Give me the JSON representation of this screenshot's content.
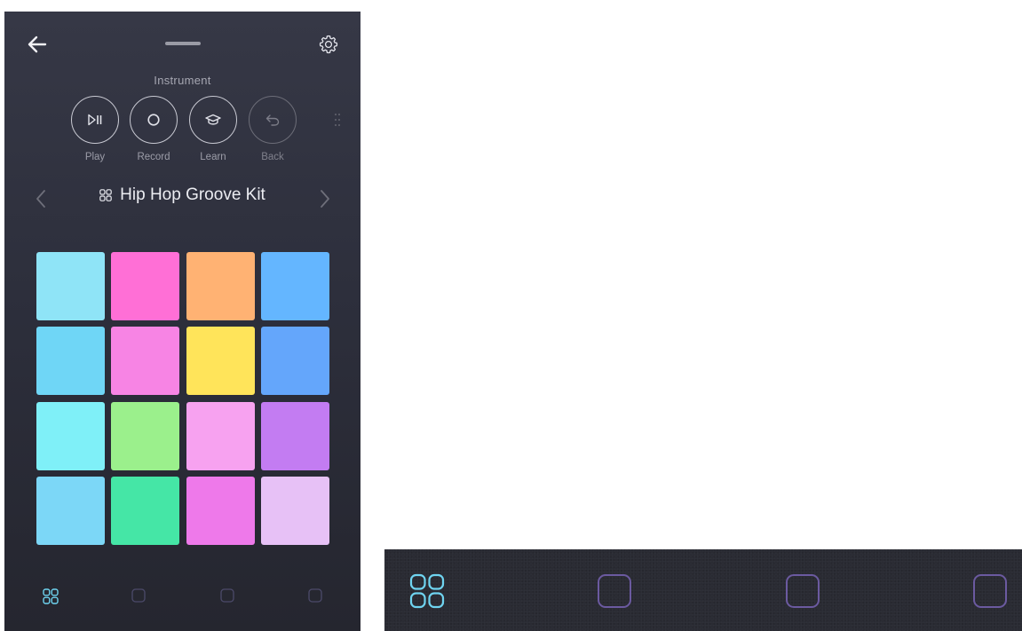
{
  "header": {
    "back_icon": "arrow-left-icon",
    "settings_icon": "gear-icon"
  },
  "instrument": {
    "label": "Instrument",
    "controls": [
      {
        "label": "Play",
        "icon": "play-pause-icon"
      },
      {
        "label": "Record",
        "icon": "record-icon"
      },
      {
        "label": "Learn",
        "icon": "graduation-cap-icon"
      },
      {
        "label": "Back",
        "icon": "undo-icon"
      }
    ]
  },
  "kit": {
    "name": "Hip Hop Groove Kit",
    "icon": "grid-icon"
  },
  "pads": {
    "colors": [
      "#8fe4f7",
      "#ff6fd6",
      "#ffb273",
      "#64b6ff",
      "#6fd6f6",
      "#f784e4",
      "#ffe45a",
      "#64a6fb",
      "#7ff0f8",
      "#9bf08c",
      "#f7a2f0",
      "#c37cf2",
      "#7cd7f7",
      "#45e6a6",
      "#ee79ea",
      "#e7c1f6"
    ]
  },
  "bottom_tabs": [
    {
      "icon": "grid-icon",
      "active": true
    },
    {
      "icon": "square-icon",
      "active": false
    },
    {
      "icon": "square-icon",
      "active": false
    },
    {
      "icon": "square-icon",
      "active": false
    }
  ],
  "colors": {
    "accent": "#6fd4f0",
    "inactive_tab": "#5a4a8a"
  }
}
